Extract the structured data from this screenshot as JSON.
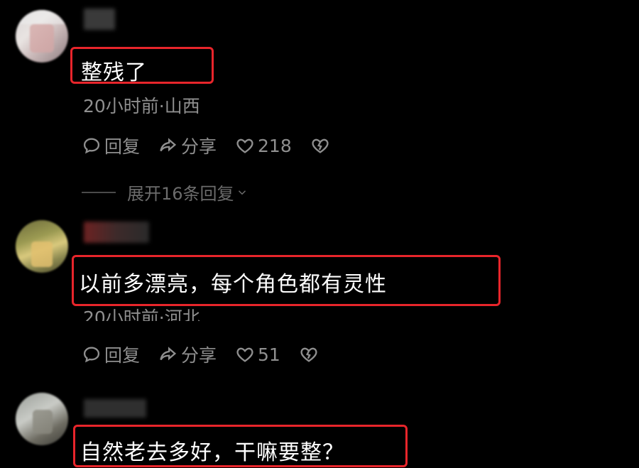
{
  "comments": [
    {
      "text": "整残了",
      "meta": "20小时前·山西",
      "reply_label": "回复",
      "share_label": "分享",
      "like_count": "218"
    },
    {
      "text": "以前多漂亮，每个角色都有灵性",
      "meta": "20小时前·河北",
      "reply_label": "回复",
      "share_label": "分享",
      "like_count": "51"
    },
    {
      "text": "自然老去多好，干嘛要整？"
    }
  ],
  "expand_replies": "展开16条回复",
  "colors": {
    "background": "#000000",
    "highlight_border": "#e8252b",
    "meta_text": "#8f8f8f"
  },
  "icons": [
    "comment-icon",
    "share-icon",
    "heart-icon",
    "broken-heart-icon",
    "chevron-down-icon"
  ]
}
